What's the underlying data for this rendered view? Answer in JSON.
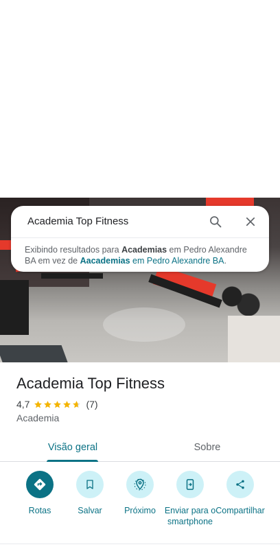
{
  "search": {
    "query": "Academia Top Fitness",
    "notice_prefix": "Exibindo resultados para ",
    "notice_term": "Academias",
    "notice_middle": " em Pedro Alexandre BA em vez de ",
    "notice_original_term": "Aacademias",
    "notice_original_location": " em Pedro Alexandre BA",
    "notice_end": "."
  },
  "place": {
    "name": "Academia Top Fitness",
    "rating": "4,7",
    "rating_value": 4.7,
    "review_count": "(7)",
    "category": "Academia"
  },
  "tabs": [
    {
      "label": "Visão geral",
      "active": true
    },
    {
      "label": "Sobre",
      "active": false
    }
  ],
  "actions": [
    {
      "label": "Rotas",
      "icon": "directions-icon"
    },
    {
      "label": "Salvar",
      "icon": "bookmark-icon"
    },
    {
      "label": "Próximo",
      "icon": "nearby-icon"
    },
    {
      "label": "Enviar para o smartphone",
      "icon": "send-to-phone-icon"
    },
    {
      "label": "Compartilhar",
      "icon": "share-icon"
    }
  ],
  "colors": {
    "accent": "#0b7285",
    "action_bg": "#cdf1f7",
    "star": "#f4b400"
  }
}
